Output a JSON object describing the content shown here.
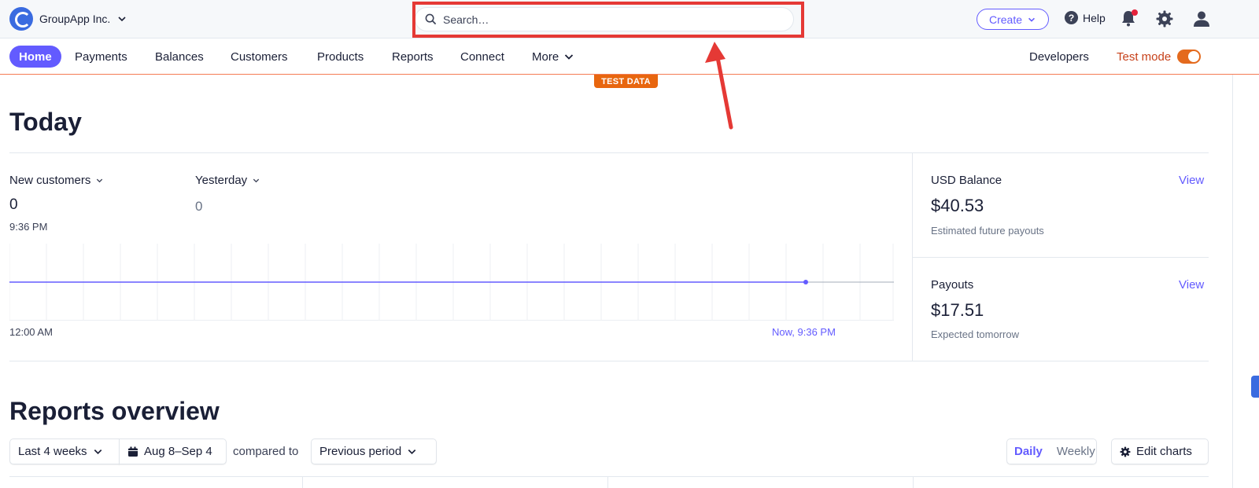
{
  "topbar": {
    "account_name": "GroupApp Inc.",
    "search_placeholder": "Search…",
    "create_label": "Create",
    "help_label": "Help"
  },
  "nav": {
    "items": [
      "Home",
      "Payments",
      "Balances",
      "Customers",
      "Products",
      "Reports",
      "Connect",
      "More"
    ],
    "active": "Home",
    "developers_label": "Developers",
    "test_mode_label": "Test mode",
    "test_mode_on": true
  },
  "badge": {
    "test_data": "TEST DATA"
  },
  "today": {
    "title": "Today",
    "metric_label": "New customers",
    "metric_value": "0",
    "metric_time": "9:36 PM",
    "compare_label": "Yesterday",
    "compare_value": "0",
    "axis_start": "12:00 AM",
    "axis_now": "Now, 9:36 PM"
  },
  "balance": {
    "title": "USD Balance",
    "view_label": "View",
    "amount": "$40.53",
    "subtitle": "Estimated future payouts"
  },
  "payouts": {
    "title": "Payouts",
    "view_label": "View",
    "amount": "$17.51",
    "subtitle": "Expected tomorrow"
  },
  "reports": {
    "title": "Reports overview",
    "range_label": "Last 4 weeks",
    "date_label": "Aug 8–Sep 4",
    "compared_to_label": "compared to",
    "comparison_label": "Previous period",
    "daily_label": "Daily",
    "weekly_label": "Weekly",
    "edit_charts_label": "Edit charts"
  },
  "colors": {
    "accent": "#635bff",
    "test_mode": "#e8660f",
    "annotation": "#e53935"
  }
}
